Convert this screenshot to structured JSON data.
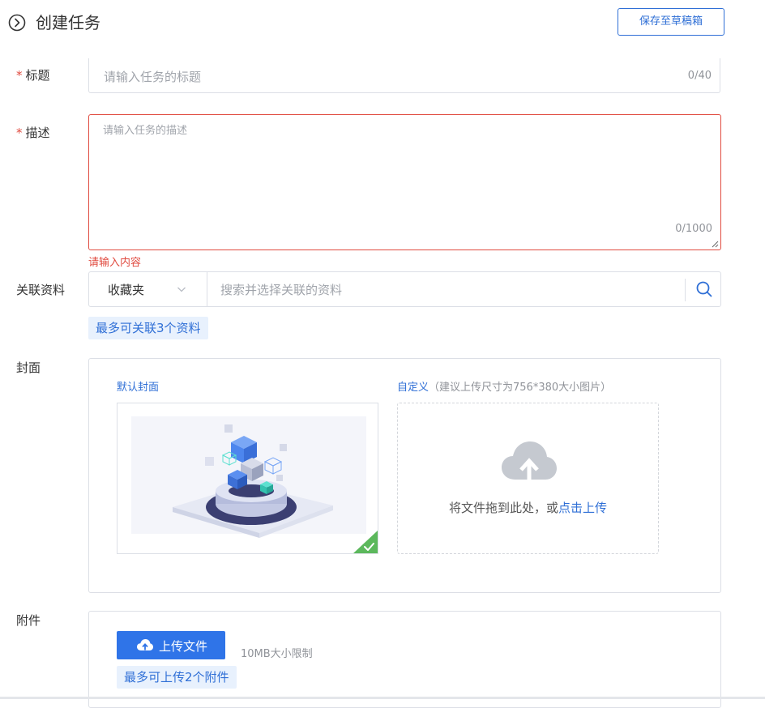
{
  "header": {
    "title": "创建任务",
    "save_draft": "保存至草稿箱"
  },
  "form": {
    "required_mark": "*",
    "title": {
      "label": "标题",
      "placeholder": "请输入任务的标题",
      "count": "0/40"
    },
    "description": {
      "label": "描述",
      "placeholder": "请输入任务的描述",
      "count": "0/1000",
      "error": "请输入内容"
    },
    "related": {
      "label": "关联资料",
      "source_selected": "收藏夹",
      "search_placeholder": "搜索并选择关联的资料",
      "limit_tag": "最多可关联3个资料"
    },
    "cover": {
      "label": "封面",
      "default_label": "默认封面",
      "custom_label": "自定义",
      "custom_hint": "（建议上传尺寸为756*380大小图片）",
      "upload_text": "将文件拖到此处，或",
      "upload_link": "点击上传",
      "default_selected": true
    },
    "attachment": {
      "label": "附件",
      "upload_button": "上传文件",
      "size_limit": "10MB大小限制",
      "limit_tag": "最多可上传2个附件"
    }
  },
  "colors": {
    "accent": "#2f6fd6",
    "error": "#e04a3f",
    "selected_check": "#5cb85c"
  }
}
